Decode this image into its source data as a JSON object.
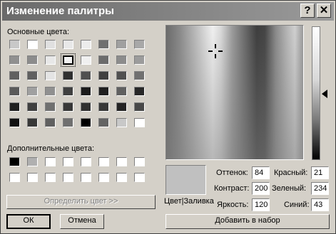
{
  "window": {
    "title": "Изменение палитры",
    "help_label": "?",
    "close_label": "✕"
  },
  "basic_colors": {
    "label": "Основные цвета:",
    "rows": [
      [
        "#c8c8c8",
        "#ffffff",
        "#e0e0e0",
        "#e8e8e8",
        "#ececec",
        "#707070",
        "#a0a0a0",
        "#a8a8a8"
      ],
      [
        "#909090",
        "#8c8c8c",
        "#e8e8e8",
        "#f2f2f2",
        "#f0f0f0",
        "#6c6c6c",
        "#8c8c8c",
        "#9c9c9c"
      ],
      [
        "#606060",
        "#606060",
        "#e4e4e4",
        "#303030",
        "#505050",
        "#404040",
        "#505050",
        "#707070"
      ],
      [
        "#5a5a5a",
        "#a0a0a0",
        "#909090",
        "#404040",
        "#1c1c1c",
        "#202020",
        "#606060",
        "#282828"
      ],
      [
        "#202020",
        "#404040",
        "#707070",
        "#383838",
        "#303030",
        "#383838",
        "#242424",
        "#484848"
      ],
      [
        "#111111",
        "#383838",
        "#606060",
        "#707070",
        "#000000",
        "#646464",
        "#c8c8c8",
        "#ffffff"
      ]
    ],
    "selected_index": [
      1,
      3
    ]
  },
  "custom_colors": {
    "label": "Дополнительные цвета:",
    "rows": [
      [
        "#000000",
        "#b0b0b0",
        "#ffffff",
        "#ffffff",
        "#ffffff",
        "#ffffff",
        "#ffffff",
        "#ffffff"
      ],
      [
        "#ffffff",
        "#ffffff",
        "#ffffff",
        "#ffffff",
        "#ffffff",
        "#ffffff",
        "#ffffff",
        "#ffffff"
      ]
    ]
  },
  "buttons": {
    "define": "Определить цвет >>",
    "ok": "ОК",
    "cancel": "Отмена",
    "add": "Добавить в набор"
  },
  "preview_label": "Цвет|Заливка",
  "fields": {
    "hue": {
      "label": "Оттенок:",
      "value": "84"
    },
    "saturation": {
      "label": "Контраст:",
      "value": "200"
    },
    "luminance": {
      "label": "Яркость:",
      "value": "120"
    },
    "red": {
      "label": "Красный:",
      "value": "21"
    },
    "green": {
      "label": "Зеленый:",
      "value": "234"
    },
    "blue": {
      "label": "Синий:",
      "value": "43"
    }
  }
}
